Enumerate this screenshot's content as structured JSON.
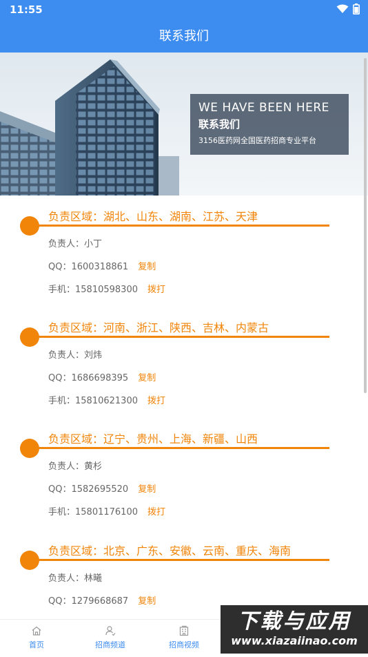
{
  "status_bar": {
    "time": "11:55"
  },
  "header": {
    "title": "联系我们"
  },
  "banner": {
    "heading_en": "WE HAVE BEEN HERE",
    "heading_cn": "联系我们",
    "subtitle": "3156医药网全国医药招商专业平台"
  },
  "regions": [
    {
      "title": "负责区域：湖北、山东、湖南、江苏、天津",
      "person": "负责人：小丁",
      "qq": "QQ：1600318861",
      "copy_label": "复制",
      "phone": "手机：15810598300",
      "call_label": "拨打"
    },
    {
      "title": "负责区域：河南、浙江、陕西、吉林、内蒙古",
      "person": "负责人：刘炜",
      "qq": "QQ：1686698395",
      "copy_label": "复制",
      "phone": "手机：15810621300",
      "call_label": "拨打"
    },
    {
      "title": "负责区域：辽宁、贵州、上海、新疆、山西",
      "person": "负责人：黄杉",
      "qq": "QQ：1582695520",
      "copy_label": "复制",
      "phone": "手机：15801176100",
      "call_label": "拨打"
    },
    {
      "title": "负责区域：北京、广东、安徽、云南、重庆、海南",
      "person": "负责人：林曦",
      "qq": "QQ：1279668687",
      "copy_label": "复制"
    }
  ],
  "bottom_nav": [
    {
      "label": "首页",
      "icon": "home-icon"
    },
    {
      "label": "招商频道",
      "icon": "user-icon"
    },
    {
      "label": "招商视频",
      "icon": "building-icon"
    }
  ],
  "watermark": {
    "title": "下载与应用",
    "url": "www.xiazaiinao.com"
  },
  "colors": {
    "primary": "#3d8cf0",
    "accent": "#f0850a",
    "text_secondary": "#666666"
  }
}
